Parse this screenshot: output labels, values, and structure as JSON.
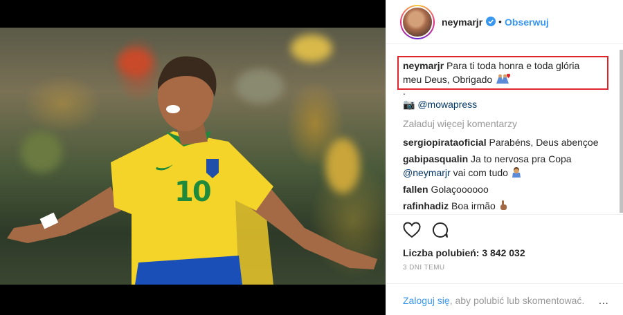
{
  "post": {
    "image_alt": "Neymar celebrating in Brazil jersey number 10",
    "jersey_number": "10"
  },
  "header": {
    "username": "neymarjr",
    "separator": "•",
    "follow_label": "Obserwuj"
  },
  "caption": {
    "username": "neymarjr",
    "text_line1": "Para ti toda honra e toda glória",
    "text_line2": "meu Deus, Obrigado",
    "dot": ".",
    "camera_emoji": "📷",
    "credit": "@mowapress"
  },
  "load_more": "Załaduj więcej komentarzy",
  "comments": [
    {
      "username": "sergiopirataoficial",
      "text": "Parabéns, Deus abençoe"
    },
    {
      "username": "gabipasqualin",
      "text": "Ja to nervosa pra Copa",
      "mention": "@neymarjr",
      "text2": "vai com tudo"
    },
    {
      "username": "fallen",
      "text": "Golaçoooooo"
    },
    {
      "username": "rafinhadiz",
      "text": "Boa irmão"
    }
  ],
  "actions": {
    "likes": "Liczba polubień: 3 842 032",
    "timestamp": "3 DNI TEMU"
  },
  "footer": {
    "login_link": "Zaloguj się",
    "login_rest": ", aby polubić lub skomentować.",
    "more_label": "..."
  },
  "colors": {
    "accent": "#3897f0",
    "highlight_box": "#e0242c",
    "jersey": "#f5d42a",
    "jersey_green": "#1f8a3c"
  }
}
